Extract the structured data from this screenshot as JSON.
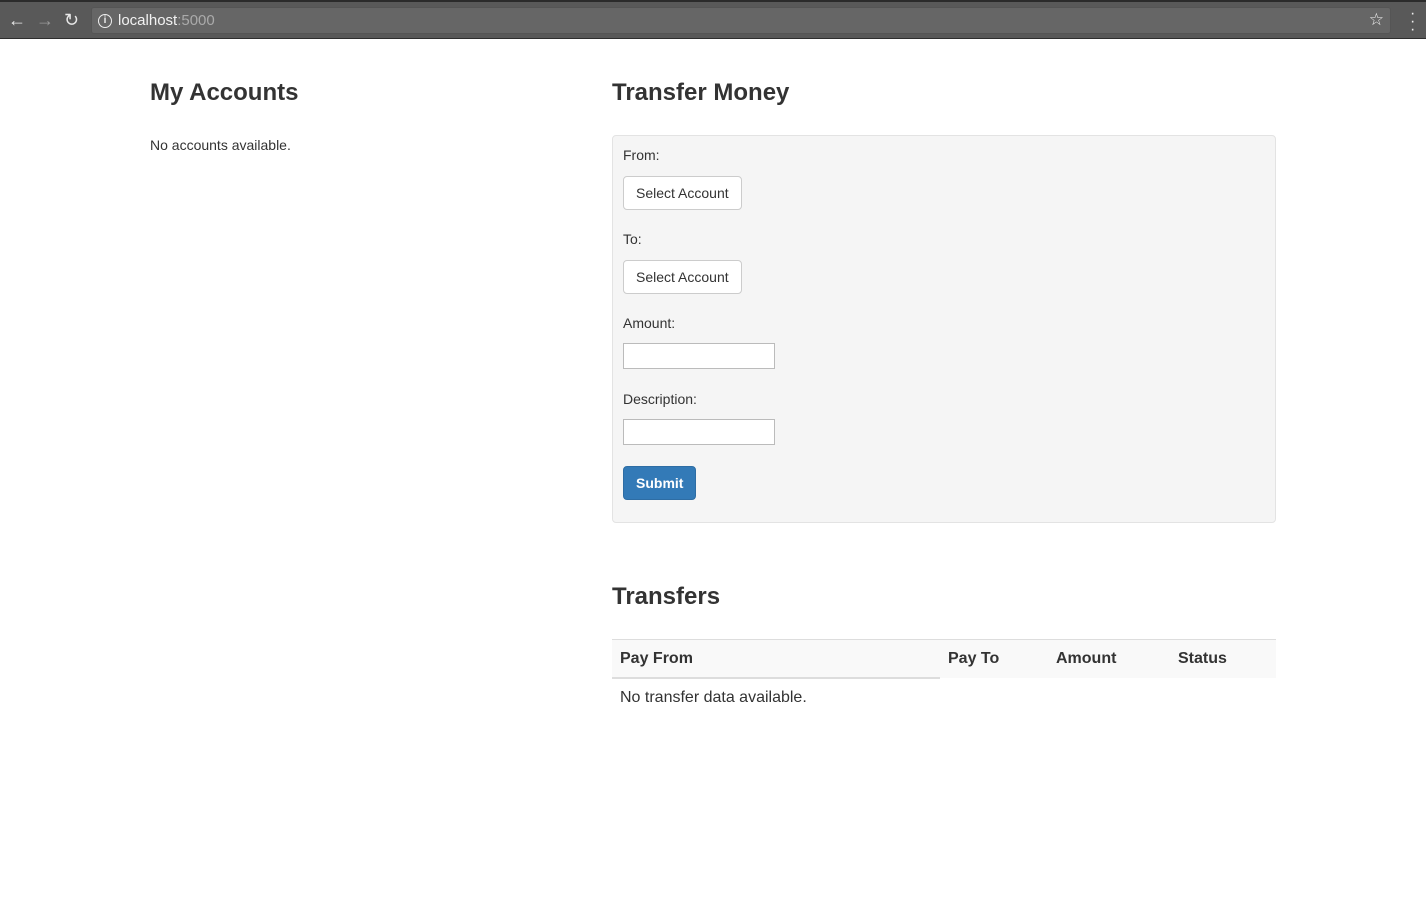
{
  "browser": {
    "url_host": "localhost",
    "url_port": ":5000"
  },
  "accounts": {
    "title": "My Accounts",
    "empty": "No accounts available."
  },
  "transfer": {
    "title": "Transfer Money",
    "from_label": "From:",
    "from_button": "Select Account",
    "to_label": "To:",
    "to_button": "Select Account",
    "amount_label": "Amount:",
    "amount_value": "",
    "description_label": "Description:",
    "description_value": "",
    "submit": "Submit"
  },
  "transfers": {
    "title": "Transfers",
    "columns": [
      "Pay From",
      "Pay To",
      "Amount",
      "Status"
    ],
    "empty": "No transfer data available."
  },
  "colors": {
    "primary": "#337ab7"
  }
}
